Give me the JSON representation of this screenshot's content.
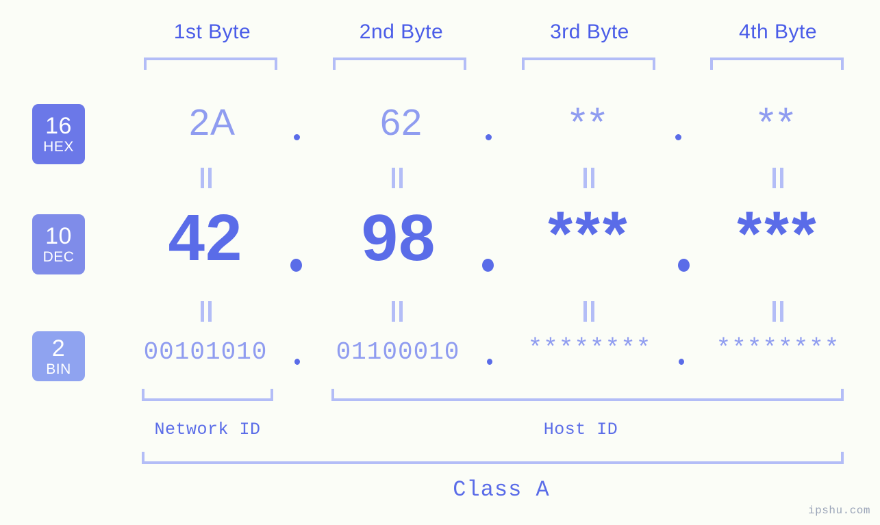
{
  "background_color": "#fbfdf7",
  "accent_colors": {
    "header_text": "#4a5ce8",
    "bracket": "#b3bdf7",
    "value_light": "#8f9cf0",
    "value_strong": "#5a6ce8",
    "badge_hex": "#6b78e8",
    "badge_dec": "#7f8ce9",
    "badge_bin": "#8fa3f0",
    "watermark": "#9aa4b8"
  },
  "byte_headers": [
    {
      "label": "1st Byte"
    },
    {
      "label": "2nd Byte"
    },
    {
      "label": "3rd Byte"
    },
    {
      "label": "4th Byte"
    }
  ],
  "radix_rows": [
    {
      "badge_number": "16",
      "badge_name": "HEX",
      "values": [
        "2A",
        "62",
        "**",
        "**"
      ],
      "separator": "."
    },
    {
      "badge_number": "10",
      "badge_name": "DEC",
      "values": [
        "42",
        "98",
        "***",
        "***"
      ],
      "separator": "."
    },
    {
      "badge_number": "2",
      "badge_name": "BIN",
      "values": [
        "00101010",
        "01100010",
        "********",
        "********"
      ],
      "separator": "."
    }
  ],
  "equals_symbol": "=",
  "groups": [
    {
      "label": "Network ID"
    },
    {
      "label": "Host ID"
    }
  ],
  "class_label": "Class A",
  "watermark": "ipshu.com"
}
